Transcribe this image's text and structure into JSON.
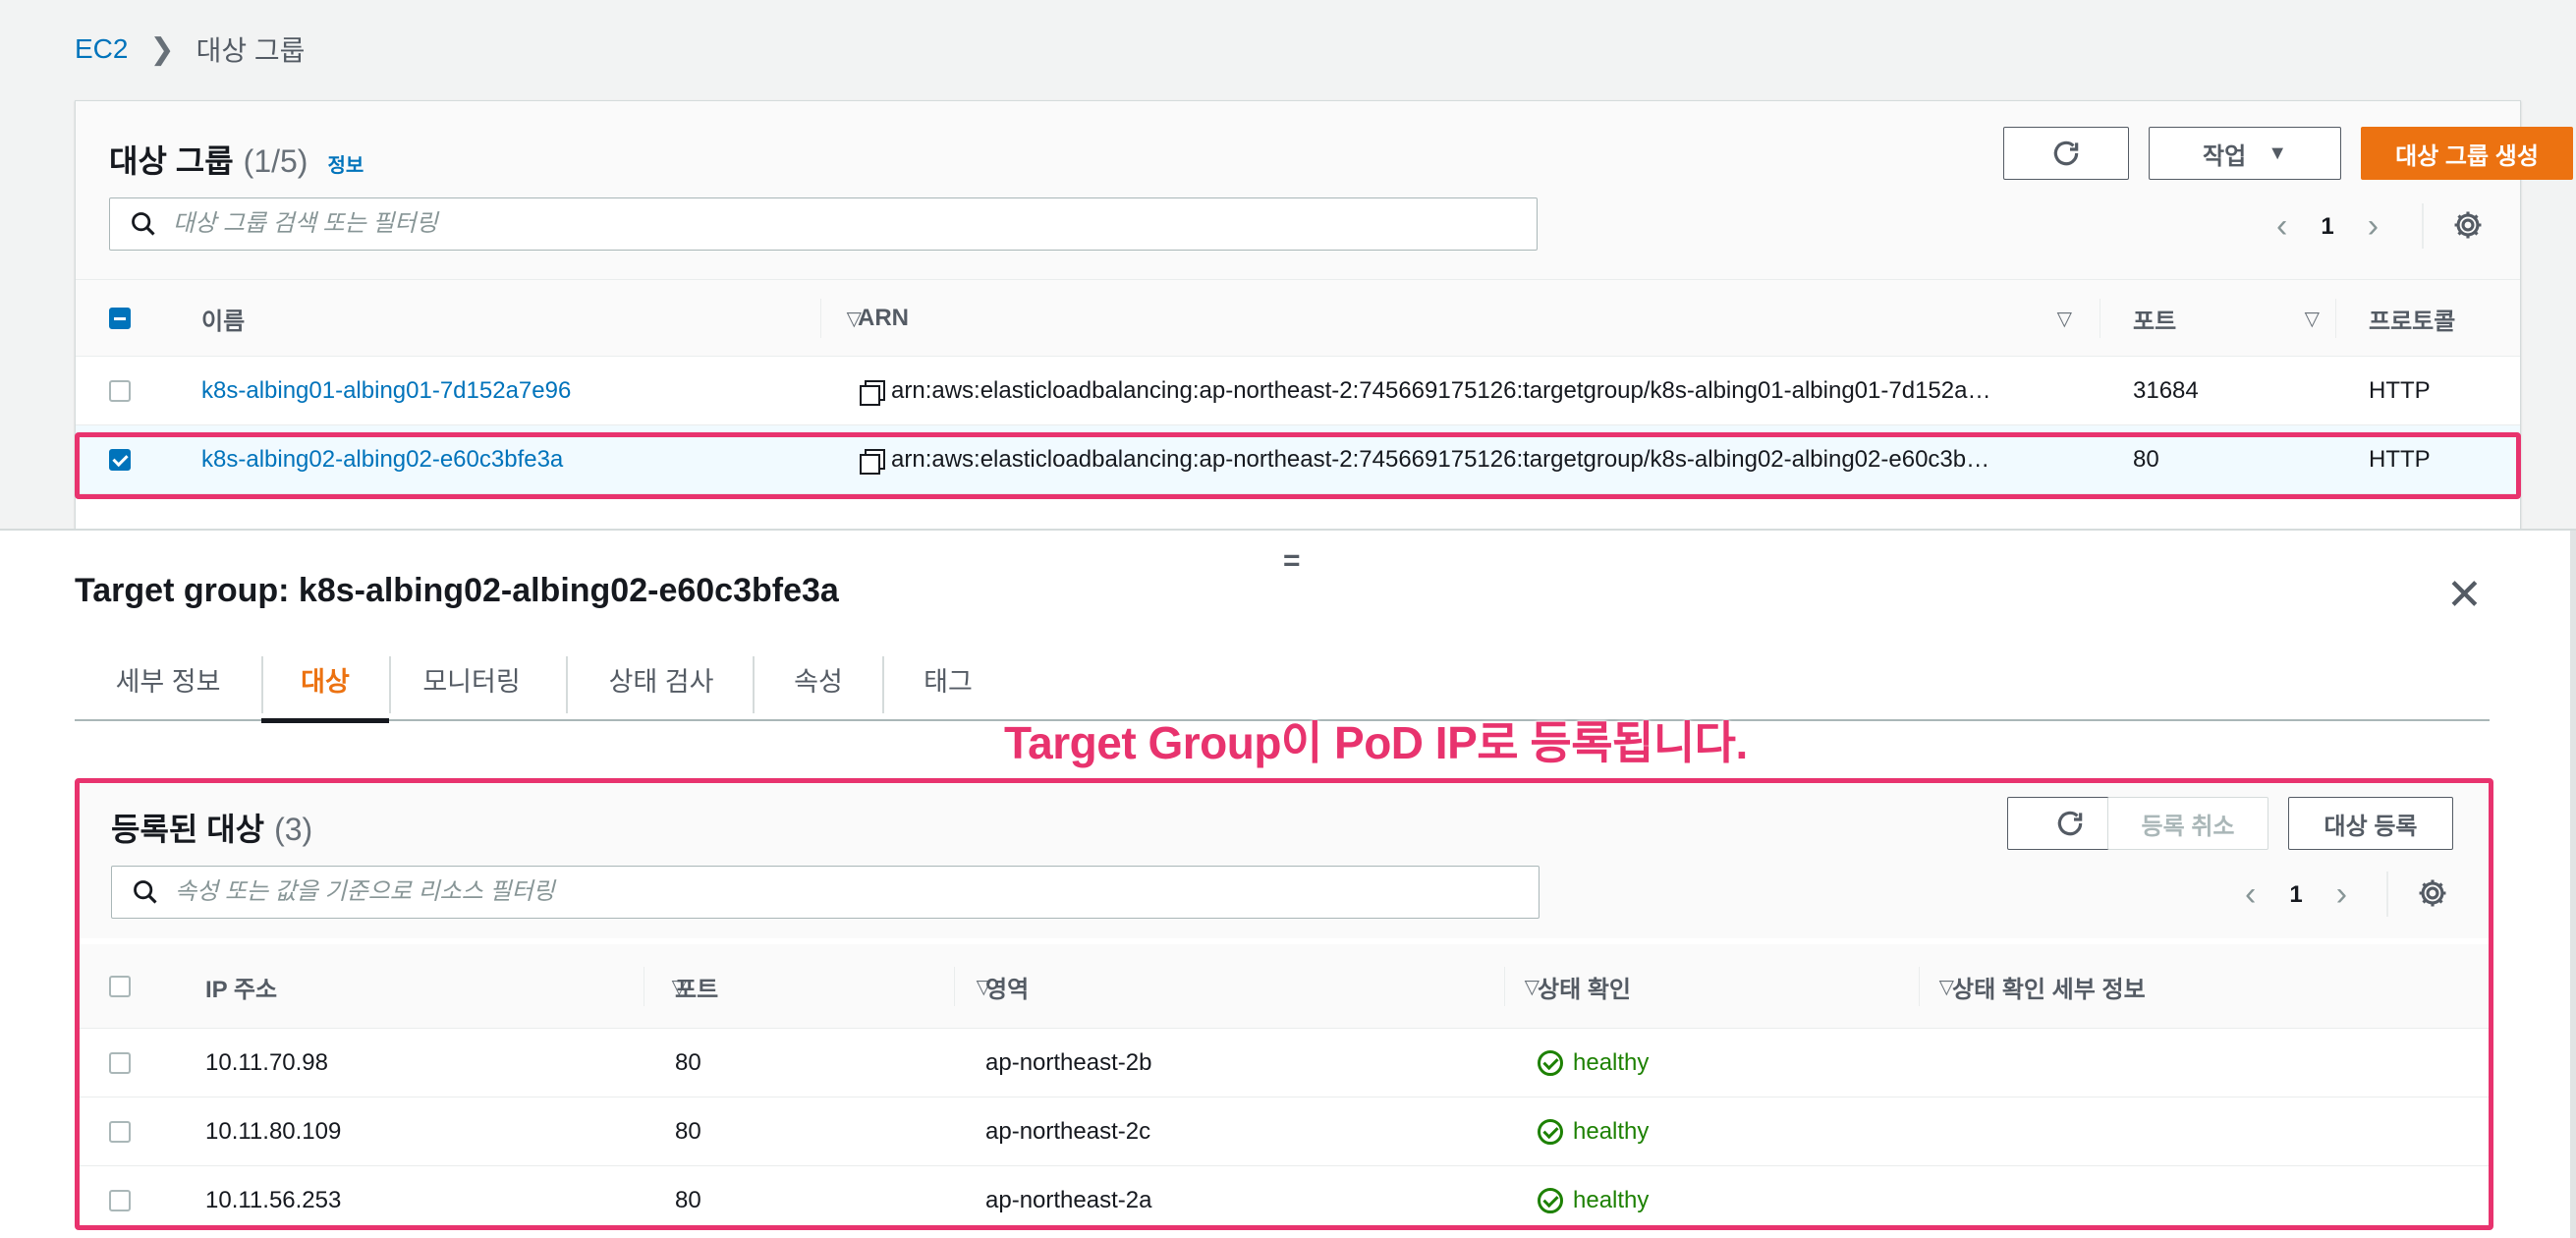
{
  "breadcrumb": {
    "root": "EC2",
    "current": "대상 그룹"
  },
  "upper": {
    "title": "대상 그룹",
    "count": "(1/5)",
    "info": "정보",
    "search_placeholder": "대상 그룹 검색 또는 필터링",
    "actions_label": "작업",
    "create_label": "대상 그룹 생성",
    "page": "1",
    "columns": {
      "name": "이름",
      "arn": "ARN",
      "port": "포트",
      "protocol": "프로토콜"
    },
    "rows": [
      {
        "name": "k8s-albing01-albing01-7d152a7e96",
        "arn": "arn:aws:elasticloadbalancing:ap-northeast-2:745669175126:targetgroup/k8s-albing01-albing01-7d152a…",
        "port": "31684",
        "protocol": "HTTP",
        "selected": false
      },
      {
        "name": "k8s-albing02-albing02-e60c3bfe3a",
        "arn": "arn:aws:elasticloadbalancing:ap-northeast-2:745669175126:targetgroup/k8s-albing02-albing02-e60c3b…",
        "port": "80",
        "protocol": "HTTP",
        "selected": true
      }
    ]
  },
  "detail": {
    "title": "Target group: k8s-albing02-albing02-e60c3bfe3a",
    "handle": "=",
    "close": "✕",
    "tabs": [
      "세부 정보",
      "대상",
      "모니터링",
      "상태 검사",
      "속성",
      "태그"
    ],
    "active_tab": "대상"
  },
  "annotation": "Target Group이 PoD IP로 등록됩니다.",
  "registered": {
    "title": "등록된 대상",
    "count": "(3)",
    "deregister_label": "등록 취소",
    "register_label": "대상 등록",
    "search_placeholder": "속성 또는 값을 기준으로 리소스 필터링",
    "page": "1",
    "columns": {
      "ip": "IP 주소",
      "port": "포트",
      "zone": "영역",
      "health": "상태 확인",
      "health_detail": "상태 확인 세부 정보"
    },
    "rows": [
      {
        "ip": "10.11.70.98",
        "port": "80",
        "zone": "ap-northeast-2b",
        "health": "healthy"
      },
      {
        "ip": "10.11.80.109",
        "port": "80",
        "zone": "ap-northeast-2c",
        "health": "healthy"
      },
      {
        "ip": "10.11.56.253",
        "port": "80",
        "zone": "ap-northeast-2a",
        "health": "healthy"
      }
    ]
  },
  "colors": {
    "accent": "#ec7211",
    "link": "#0073bb",
    "highlight": "#e8336e",
    "healthy": "#1d8102"
  }
}
